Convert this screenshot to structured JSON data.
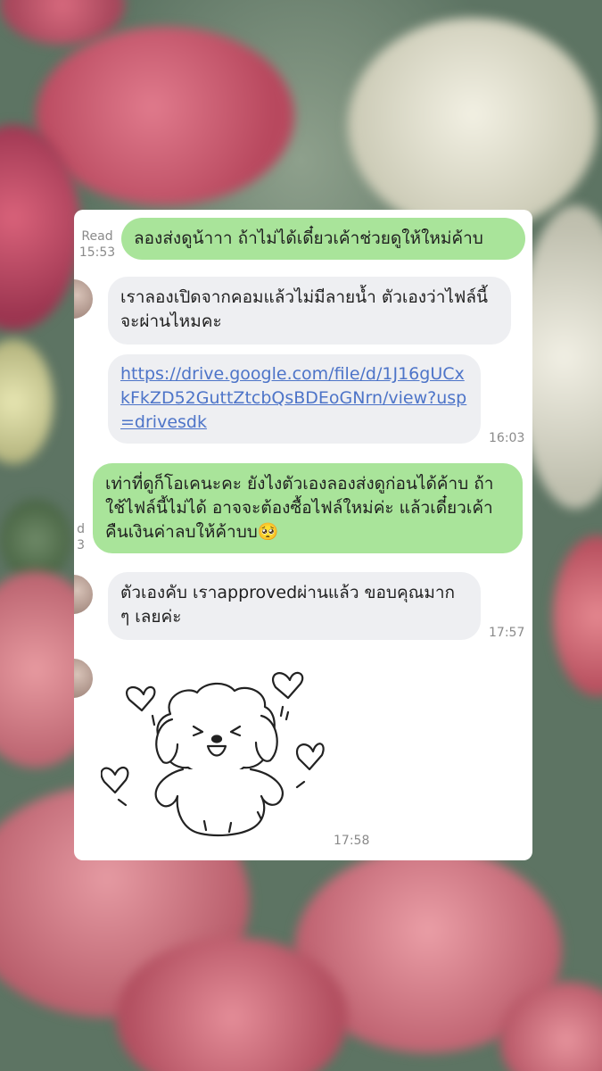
{
  "messages": [
    {
      "sender": "me",
      "text": "ลองส่งดูน้าาา ถ้าไม่ได้เดี๋ยวเค้าช่วยดูให้ใหม่ค้าบ",
      "status": "Read",
      "time": "15:53"
    },
    {
      "sender": "them",
      "text": "เราลองเปิดจากคอมแล้วไม่มีลายน้ำ ตัวเองว่าไฟล์นี้จะผ่านไหมคะ"
    },
    {
      "sender": "them",
      "link": "https://drive.google.com/file/d/1J16gUCxkFkZD52GuttZtcbQsBDEoGNrn/view?usp=drivesdk",
      "time": "16:03"
    },
    {
      "sender": "me",
      "text": "เท่าที่ดูก็โอเคนะคะ ยังไงตัวเองลองส่งดูก่อนได้ค้าบ ถ้าใช้ไฟล์นี้ไม่ได้ อาจจะต้องซื้อไฟล์ใหม่ค่ะ แล้วเดี๋ยวเค้าคืนเงินค่าลบให้ค้าบบ🥺",
      "cut_meta": "d 3"
    },
    {
      "sender": "them",
      "text": "ตัวเองคับ เราapprovedผ่านแล้ว ขอบคุณมาก ๆ เลยค่ะ",
      "time": "17:57"
    },
    {
      "sender": "them",
      "sticker": "puppy-hearts",
      "time": "17:58"
    }
  ],
  "colors": {
    "mine_bubble": "#a9e49a",
    "their_bubble": "#eeeff2",
    "link": "#4d74c8"
  }
}
